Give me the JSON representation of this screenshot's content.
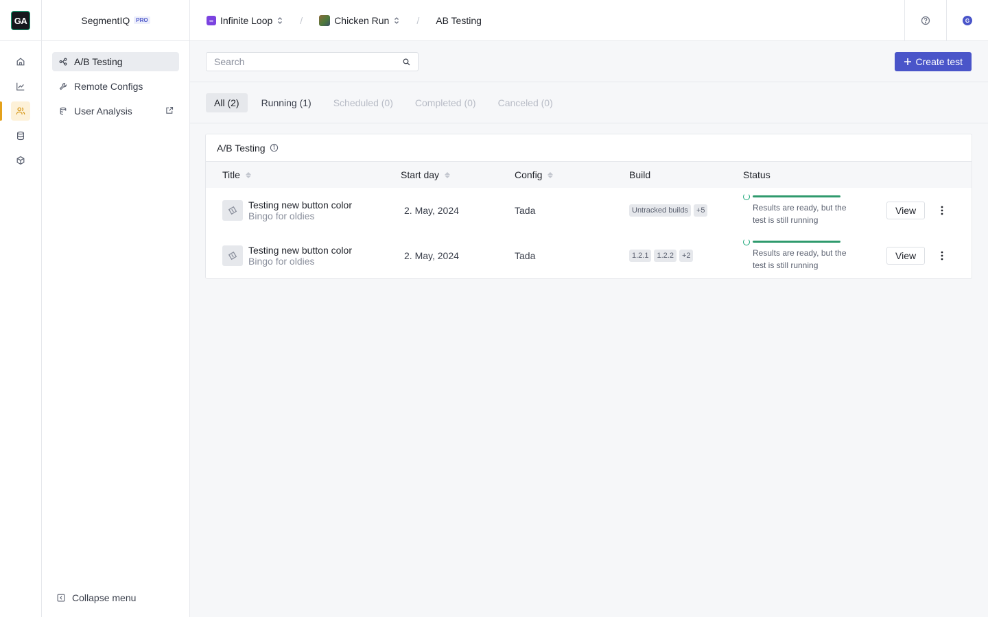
{
  "app": {
    "logo_text": "GA",
    "brand_name": "SegmentIQ",
    "brand_badge": "PRO"
  },
  "rail": {
    "items": [
      {
        "icon": "home-icon",
        "active": false
      },
      {
        "icon": "line-chart-icon",
        "active": false
      },
      {
        "icon": "users-icon",
        "active": true
      },
      {
        "icon": "database-icon",
        "active": false
      },
      {
        "icon": "cube-icon",
        "active": false
      }
    ]
  },
  "subnav": {
    "items": [
      {
        "label": "A/B Testing",
        "icon": "ab-branch-icon",
        "active": true
      },
      {
        "label": "Remote Configs",
        "icon": "wrench-icon",
        "active": false
      },
      {
        "label": "User Analysis",
        "icon": "stack-icon",
        "active": false,
        "external": true
      }
    ],
    "collapse_label": "Collapse menu"
  },
  "breadcrumb": {
    "studio": "Infinite Loop",
    "game": "Chicken Run",
    "page": "AB Testing",
    "separator": "/"
  },
  "topbar": {
    "avatar_initial": "G"
  },
  "toolbar": {
    "search_placeholder": "Search",
    "create_label": "Create test"
  },
  "tabs": [
    {
      "label": "All (2)",
      "state": "active"
    },
    {
      "label": "Running (1)",
      "state": "normal"
    },
    {
      "label": "Scheduled (0)",
      "state": "disabled"
    },
    {
      "label": "Completed (0)",
      "state": "disabled"
    },
    {
      "label": "Canceled (0)",
      "state": "disabled"
    }
  ],
  "table": {
    "title": "A/B Testing",
    "columns": {
      "title": "Title",
      "start_day": "Start day",
      "config": "Config",
      "build": "Build",
      "status": "Status"
    },
    "rows": [
      {
        "title": "Testing new button color",
        "subtitle": "Bingo for oldies",
        "start_day": "2. May, 2024",
        "config": "Tada",
        "builds": [
          "Untracked builds",
          "+5"
        ],
        "progress": 1.0,
        "status_text": "Results are ready, but the test is still running",
        "action": "View"
      },
      {
        "title": "Testing new button color",
        "subtitle": "Bingo for oldies",
        "start_day": "2. May, 2024",
        "config": "Tada",
        "builds": [
          "1.2.1",
          "1.2.2",
          "+2"
        ],
        "progress": 1.0,
        "status_text": "Results are ready, but the test is still running",
        "action": "View"
      }
    ]
  }
}
